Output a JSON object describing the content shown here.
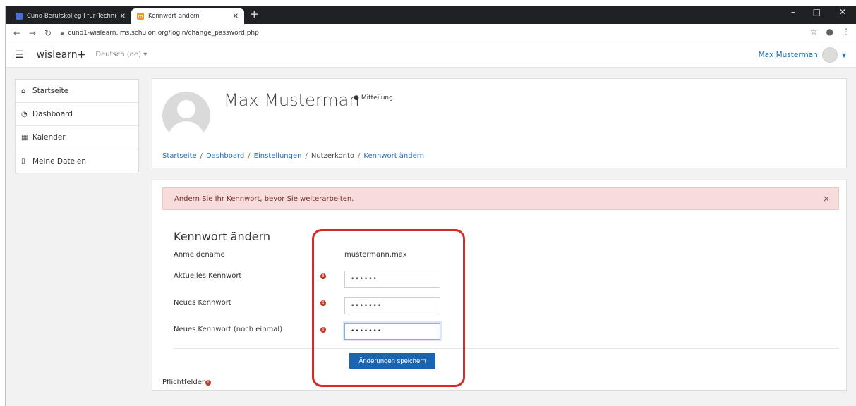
{
  "browser": {
    "tabs": [
      {
        "title": "Cuno-Berufskolleg I für Technik o",
        "active": false
      },
      {
        "title": "Kennwort ändern",
        "active": true
      }
    ],
    "new_tab": "+",
    "url": "cuno1-wislearn.lms.schulon.org/login/change_password.php",
    "window_controls": [
      "–",
      "□",
      "✕"
    ]
  },
  "navbar": {
    "brand": "wislearn+",
    "language": "Deutsch (de)",
    "user_name": "Max Musterman"
  },
  "sidebar": {
    "items": [
      {
        "label": "Startseite",
        "icon": "home-icon"
      },
      {
        "label": "Dashboard",
        "icon": "dashboard-icon"
      },
      {
        "label": "Kalender",
        "icon": "calendar-icon"
      },
      {
        "label": "Meine Dateien",
        "icon": "file-icon"
      }
    ]
  },
  "header": {
    "full_name": "Max Musterman",
    "message_link": "Mitteilung",
    "breadcrumb": [
      {
        "label": "Startseite",
        "link": true
      },
      {
        "label": "Dashboard",
        "link": true
      },
      {
        "label": "Einstellungen",
        "link": true
      },
      {
        "label": "Nutzerkonto",
        "link": false
      },
      {
        "label": "Kennwort ändern",
        "link": true
      }
    ]
  },
  "alert": {
    "text": "Ändern Sie Ihr Kennwort, bevor Sie weiterarbeiten.",
    "close": "×"
  },
  "form": {
    "title": "Kennwort ändern",
    "username_label": "Anmeldename",
    "username_value": "mustermann.max",
    "current_password_label": "Aktuelles Kennwort",
    "current_password_value": "••••••",
    "new_password_label": "Neues Kennwort",
    "new_password_value": "•••••••",
    "new_password_again_label": "Neues Kennwort (noch einmal)",
    "new_password_again_value": "•••••••",
    "save_label": "Änderungen speichern",
    "required_note": "Pflichtfelder",
    "required_icon": "!"
  },
  "colors": {
    "accent": "#1a65b2",
    "link": "#1f6fbf",
    "alert_bg": "#f7dcdc",
    "required": "#c0392b",
    "highlight": "#d62a2a"
  }
}
